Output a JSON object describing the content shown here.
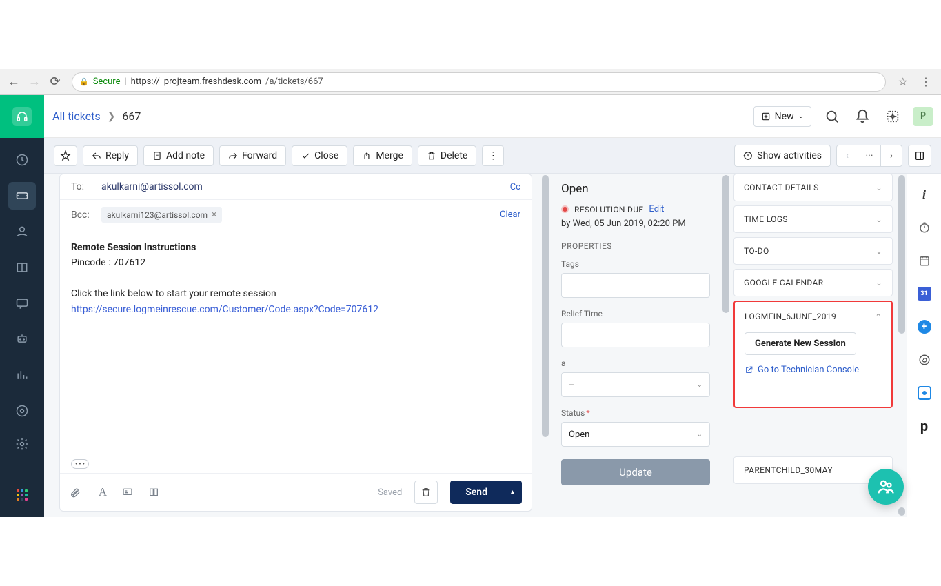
{
  "browser": {
    "secure": "Secure",
    "url_proto": "https://",
    "url_host": "projteam.freshdesk.com",
    "url_path": "/a/tickets/667"
  },
  "breadcrumb": {
    "all_tickets": "All tickets",
    "ticket_id": "667"
  },
  "topbar": {
    "new_label": "New",
    "avatar_initial": "P"
  },
  "actions": {
    "reply": "Reply",
    "add_note": "Add note",
    "forward": "Forward",
    "close": "Close",
    "merge": "Merge",
    "delete": "Delete",
    "show_activities": "Show activities"
  },
  "email": {
    "to_label": "To:",
    "to_value": "akulkarni@artissol.com",
    "bcc_label": "Bcc:",
    "bcc_chip": "akulkarni123@artissol.com",
    "cc": "Cc",
    "clear": "Clear",
    "body_title": "Remote Session Instructions",
    "body_pincode": "Pincode : 707612",
    "body_line": "Click the link below to start your remote session",
    "body_link": "https://secure.logmeinrescue.com/Customer/Code.aspx?Code=707612",
    "saved": "Saved",
    "send": "Send"
  },
  "properties": {
    "status_value": "Open",
    "resolution_due": "RESOLUTION DUE",
    "edit": "Edit",
    "due_by": "by Wed, 05 Jun 2019, 02:20 PM",
    "section": "PROPERTIES",
    "tags": "Tags",
    "relief_time": "Relief Time",
    "a_label": "a",
    "a_placeholder": "--",
    "status_label": "Status",
    "status_select": "Open",
    "update": "Update"
  },
  "panels": {
    "contact_details": "CONTACT DETAILS",
    "time_logs": "TIME LOGS",
    "todo": "TO-DO",
    "google_calendar": "GOOGLE CALENDAR",
    "logmein": "LOGMEIN_6JUNE_2019",
    "generate": "Generate New Session",
    "tech_console": "Go to Technician Console",
    "parentchild": "PARENTCHILD_30MAY"
  },
  "apps": {
    "calendar_num": "31",
    "p_letter": "p"
  }
}
